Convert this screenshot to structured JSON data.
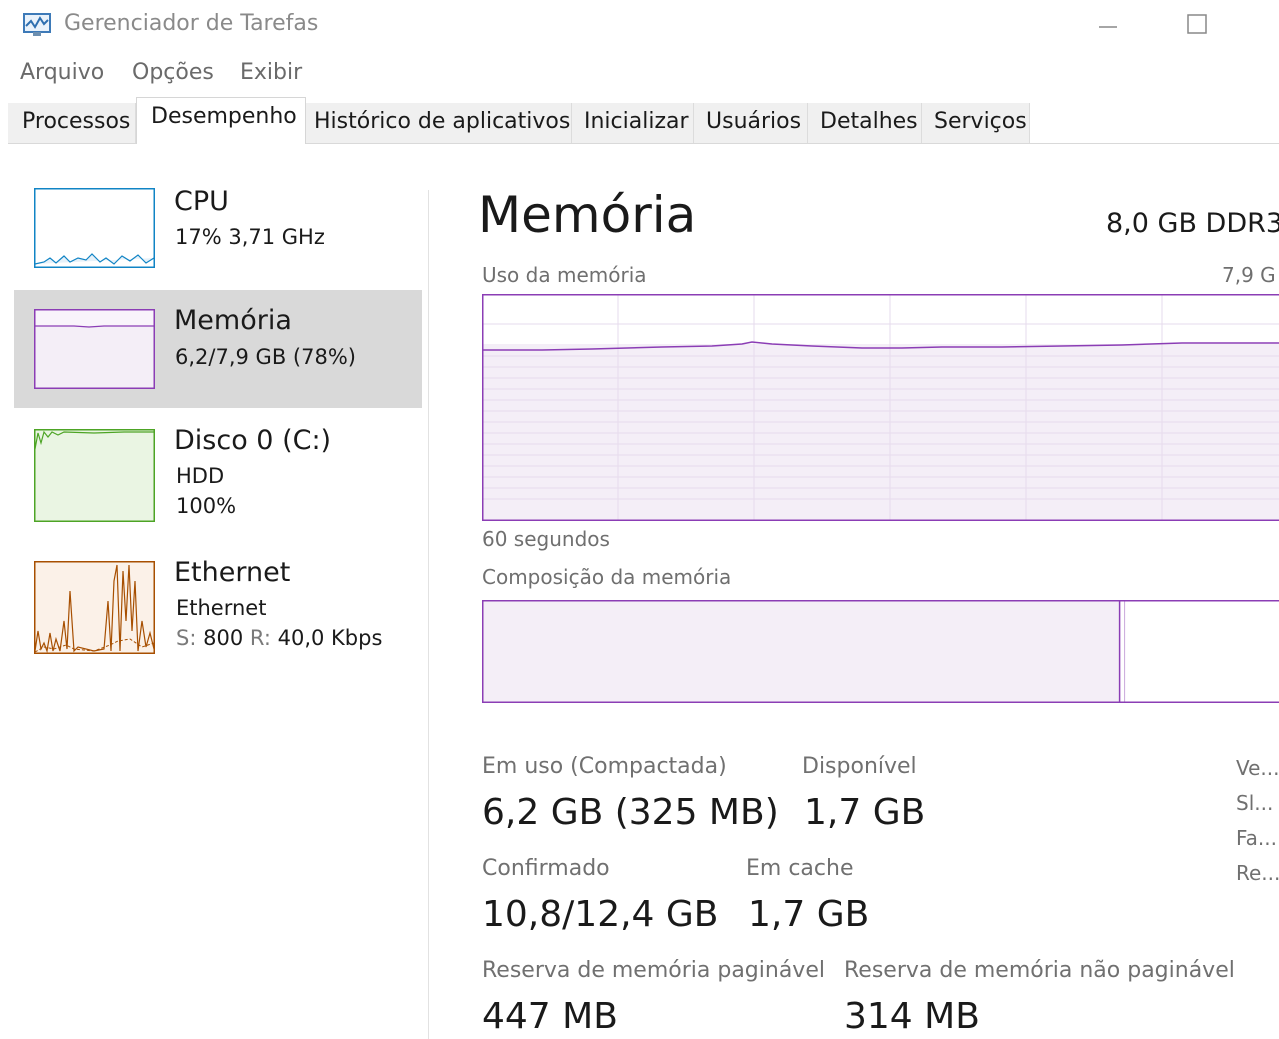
{
  "window": {
    "title": "Gerenciador de Tarefas",
    "icon": "task-manager-icon"
  },
  "menu": [
    "Arquivo",
    "Opções",
    "Exibir"
  ],
  "tabs": [
    {
      "label": "Processos",
      "active": false
    },
    {
      "label": "Desempenho",
      "active": true
    },
    {
      "label": "Histórico de aplicativos",
      "active": false
    },
    {
      "label": "Inicializar",
      "active": false
    },
    {
      "label": "Usuários",
      "active": false
    },
    {
      "label": "Detalhes",
      "active": false
    },
    {
      "label": "Serviços",
      "active": false
    }
  ],
  "resources": [
    {
      "name": "CPU",
      "line1": "17% 3,71 GHz",
      "color": "#1184c5",
      "selected": false
    },
    {
      "name": "Memória",
      "line1": "6,2/7,9 GB (78%)",
      "color": "#8b3db5",
      "selected": true
    },
    {
      "name": "Disco 0 (C:)",
      "line1": "HDD",
      "line2": "100%",
      "color": "#4da425",
      "selected": false
    },
    {
      "name": "Ethernet",
      "line1": "Ethernet",
      "send_label": "S:",
      "send_value": "800",
      "recv_label": "R:",
      "recv_value": "40,0 Kbps",
      "color": "#a74f01",
      "selected": false
    }
  ],
  "detail": {
    "title": "Memória",
    "spec": "8,0 GB DDR3",
    "usage_label": "Uso da memória",
    "usage_max": "7,9 G",
    "time_label": "60 segundos",
    "composition_label": "Composição da memória",
    "usage_percent": 78,
    "in_use_fraction": 0.8,
    "stats": {
      "in_use_label": "Em uso (Compactada)",
      "in_use_value": "6,2 GB (325 MB)",
      "available_label": "Disponível",
      "available_value": "1,7 GB",
      "committed_label": "Confirmado",
      "committed_value": "10,8/12,4 GB",
      "cached_label": "Em cache",
      "cached_value": "1,7 GB",
      "paged_label": "Reserva de memória paginável",
      "paged_value": "447 MB",
      "nonpaged_label": "Reserva de memória não paginável",
      "nonpaged_value": "314 MB"
    },
    "side_labels": [
      "Ve...",
      "Sl...",
      "Fa...",
      "Re..."
    ]
  },
  "colors": {
    "memory": "#8b3db5",
    "memory_fill": "#f4eef7",
    "grid": "#e3d6ea",
    "selected_bg": "#d9d9d9"
  }
}
